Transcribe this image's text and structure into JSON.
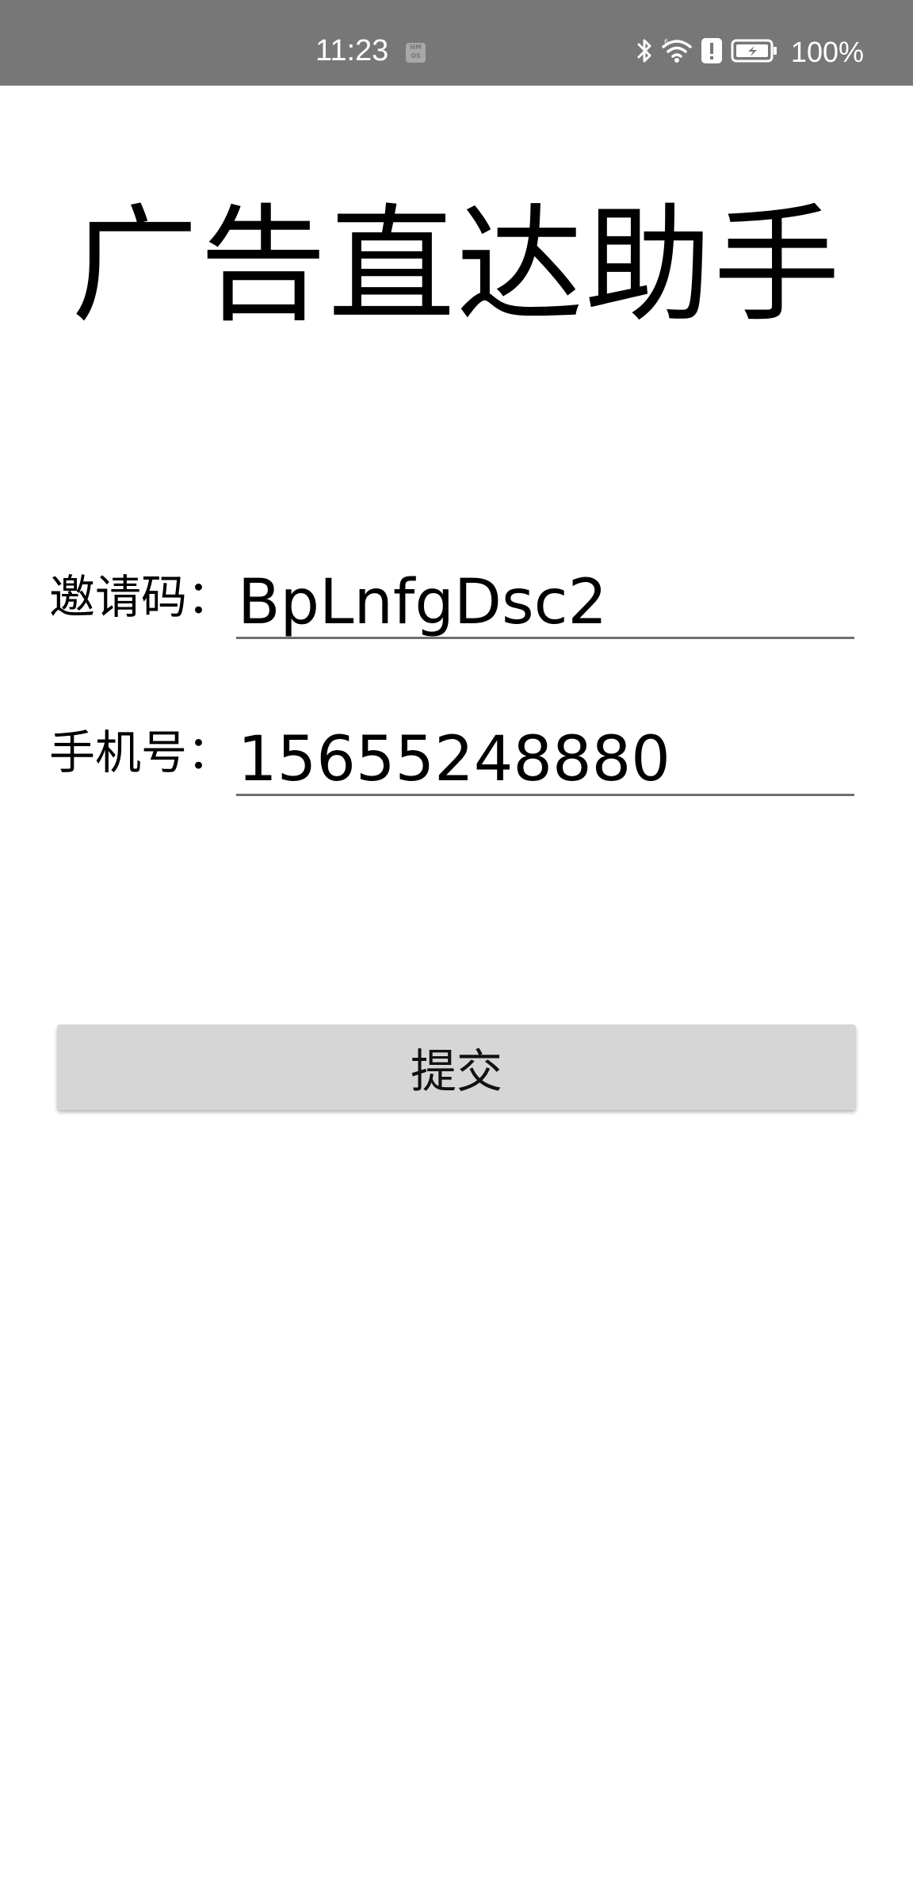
{
  "status_bar": {
    "time": "11:23",
    "hmos_badge": "HM OS",
    "battery": "100%",
    "icons": [
      "bluetooth-icon",
      "wifi-icon",
      "alert-icon",
      "battery-charging-icon"
    ]
  },
  "app": {
    "title": "广告直达助手"
  },
  "form": {
    "invite_label": "邀请码：",
    "invite_value": "BpLnfgDsc2",
    "phone_label": "手机号：",
    "phone_value": "15655248880"
  },
  "actions": {
    "submit_label": "提交"
  },
  "colors": {
    "status_bar_bg": "#777777",
    "button_bg": "#d6d6d6",
    "underline": "#6e6e6e"
  }
}
